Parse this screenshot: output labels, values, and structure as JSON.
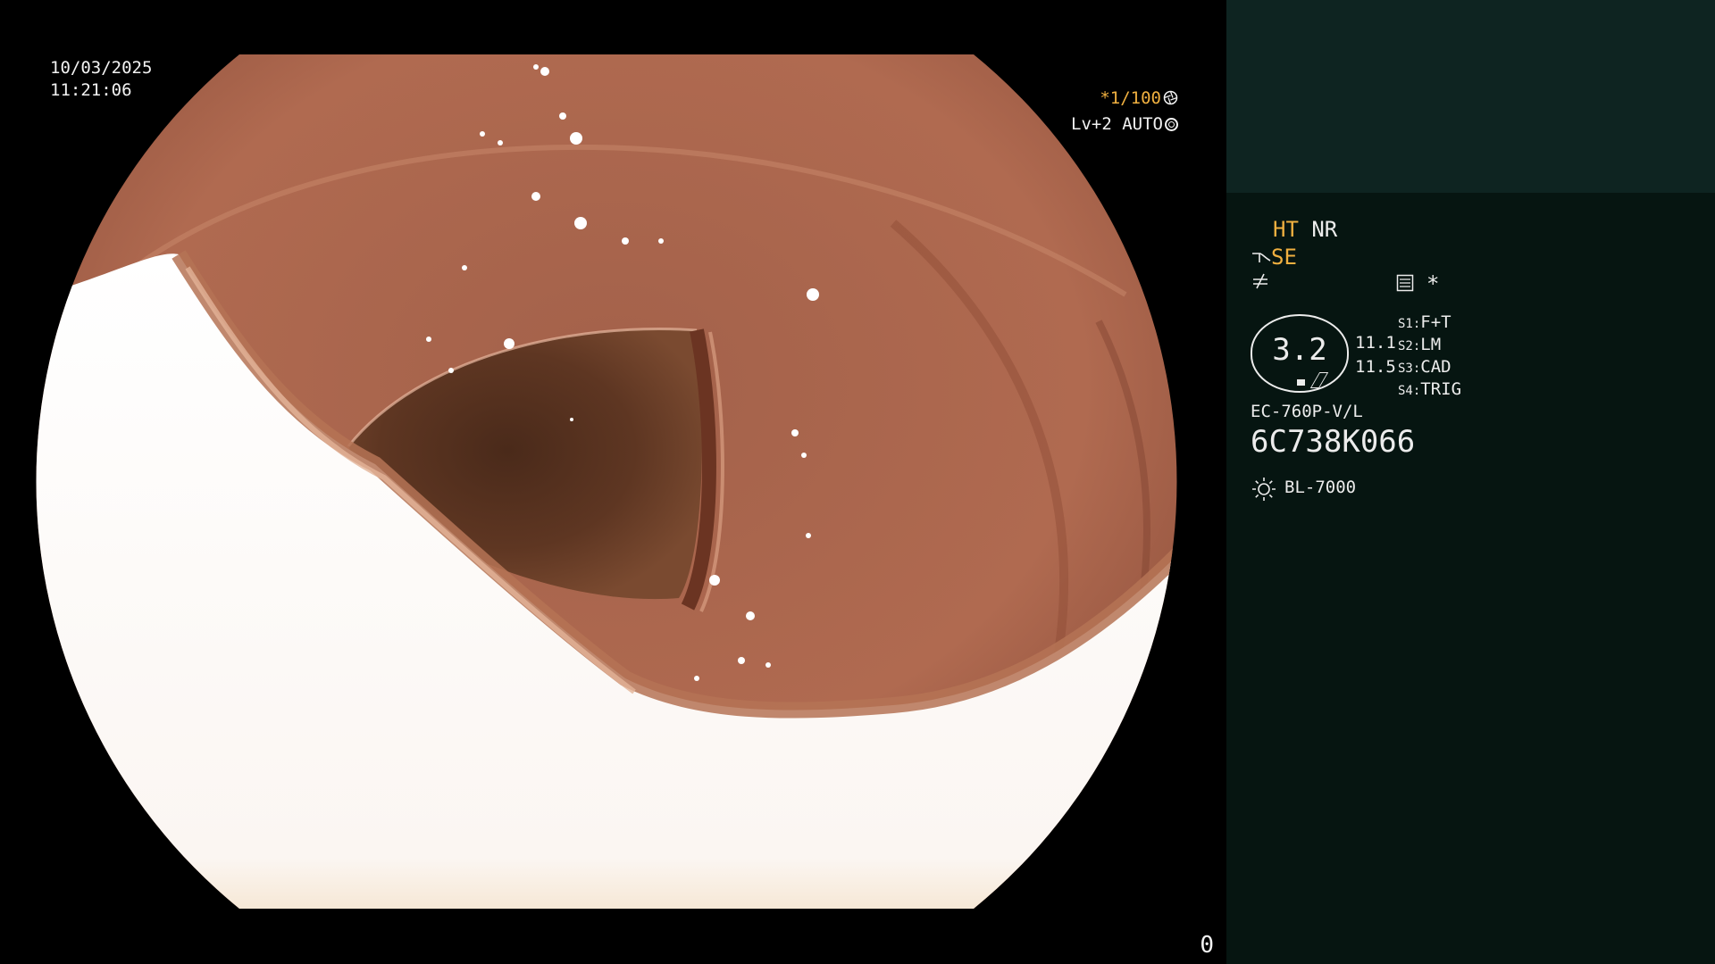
{
  "viewport": {
    "date": "10/03/2025",
    "time": "11:21:06",
    "shutter_prefix": "*",
    "shutter": "1/100",
    "shutter_icon": "aperture-icon",
    "level": "Lv+2",
    "iris_mode": "AUTO",
    "iris_icon": "iris-ring-icon",
    "mode_indicator": "0"
  },
  "side_panel": {
    "ht": "HT",
    "nr": "NR",
    "se_icon": "contrast-icon",
    "se": "SE",
    "filter_icon": "noise-filter-icon",
    "memo_icon": "memo-icon",
    "star": "*",
    "zoom": {
      "value": "3.2",
      "reading_a": "11.1",
      "reading_b": "11.5"
    },
    "switches": [
      {
        "key": "S1:",
        "label": "F+T"
      },
      {
        "key": "S2:",
        "label": "LM"
      },
      {
        "key": "S3:",
        "label": "CAD"
      },
      {
        "key": "S4:",
        "label": "TRIG"
      }
    ],
    "scope_model": "EC-760P-V/L",
    "scope_serial": "6C738K066",
    "light_icon": "sun-icon",
    "light_source": "BL-7000"
  },
  "colors": {
    "panel_bg": "#061511",
    "panel_top_bg": "#0e2421",
    "amber": "#f0b040",
    "text": "#ececec"
  }
}
